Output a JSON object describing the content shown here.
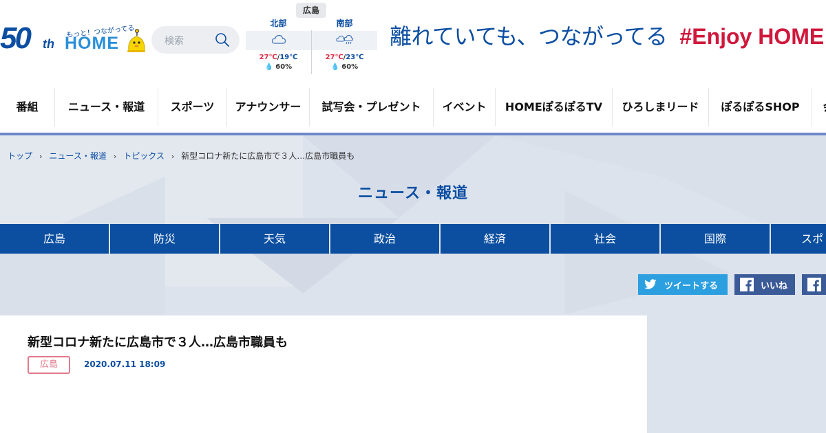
{
  "header": {
    "logo": {
      "anniversary": "50",
      "anniversary_suffix": "th",
      "tagline": "もっと！つながってる",
      "brand": "HOME"
    },
    "search": {
      "placeholder": "検索"
    },
    "weather": {
      "region": "広島",
      "areas": [
        {
          "name": "北部",
          "icon": "cloud-icon",
          "high": "27℃",
          "low": "19℃",
          "rain": "60%"
        },
        {
          "name": "南部",
          "icon": "cloud-rain-icon",
          "high": "27℃",
          "low": "23℃",
          "rain": "60%"
        }
      ]
    },
    "banner": {
      "slogan": "離れていても、つながってる",
      "hashtag": "#Enjoy HOME"
    }
  },
  "global_nav": {
    "items": [
      "番組",
      "ニュース・報道",
      "スポーツ",
      "アナウンサー",
      "試写会・プレゼント",
      "イベント",
      "HOMEぽるぽるTV",
      "ひろしまリード",
      "ぽるぽるSHOP",
      "会"
    ]
  },
  "breadcrumb": {
    "items": [
      "トップ",
      "ニュース・報道",
      "トピックス"
    ],
    "current": "新型コロナ新たに広島市で３人…広島市職員も"
  },
  "section": {
    "title": "ニュース・報道"
  },
  "categories": [
    "広島",
    "防災",
    "天気",
    "政治",
    "経済",
    "社会",
    "国際",
    "スポ"
  ],
  "share": {
    "tweet_label": "ツイートする",
    "like_label": "いいね"
  },
  "article": {
    "title": "新型コロナ新たに広島市で３人…広島市職員も",
    "category": "広島",
    "date": "2020.07.11 18:09"
  },
  "colors": {
    "brand_blue": "#0b4ea2",
    "accent_red": "#d0183c",
    "twitter": "#2c9fe0",
    "facebook": "#3a5a98",
    "badge_pink": "#e2798b"
  }
}
